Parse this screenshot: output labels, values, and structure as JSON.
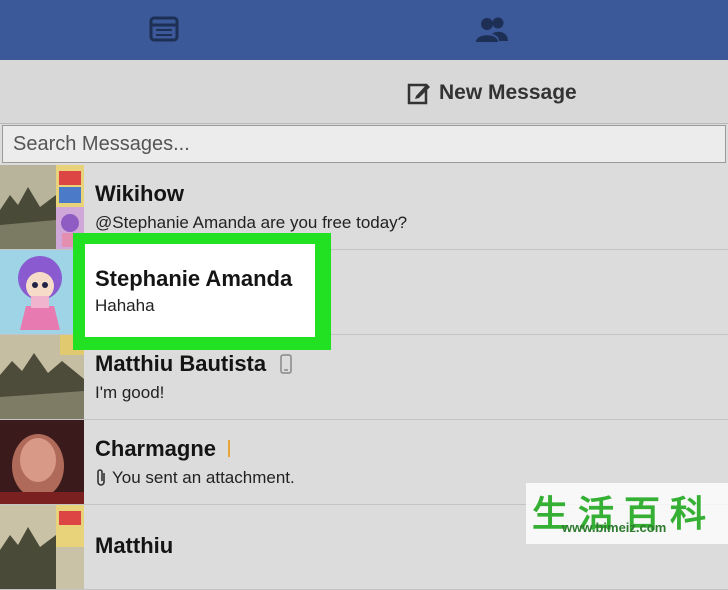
{
  "topbar": {
    "tabs": [
      {
        "icon": "browser-window-icon"
      },
      {
        "icon": "friends-icon"
      }
    ]
  },
  "toolbar": {
    "new_message_label": "New Message",
    "icon": "compose-icon"
  },
  "search": {
    "placeholder": "Search Messages..."
  },
  "conversations": [
    {
      "name": "Wikihow",
      "snippet": "@Stephanie Amanda are you free today?",
      "avatar": "group-photo-avatar"
    },
    {
      "name": "Stephanie Amanda",
      "snippet": "Hahaha",
      "avatar": "doll-avatar",
      "highlighted": true
    },
    {
      "name": "Matthiu Bautista",
      "snippet": "I'm good!",
      "avatar": "landscape-avatar",
      "badge": "mobile-icon"
    },
    {
      "name": "Charmagne",
      "snippet": "You sent an attachment.",
      "avatar": "blurred-portrait-avatar",
      "snippet_icon": "paperclip-icon"
    },
    {
      "name": "Matthiu",
      "snippet": "",
      "avatar": "group-photo-avatar"
    }
  ],
  "colors": {
    "header": "#3b5998",
    "highlight": "#22e022",
    "list_bg": "#dcdcdc"
  },
  "watermark": {
    "chinese": "生活百科",
    "url": "www.bimeiz.com"
  }
}
